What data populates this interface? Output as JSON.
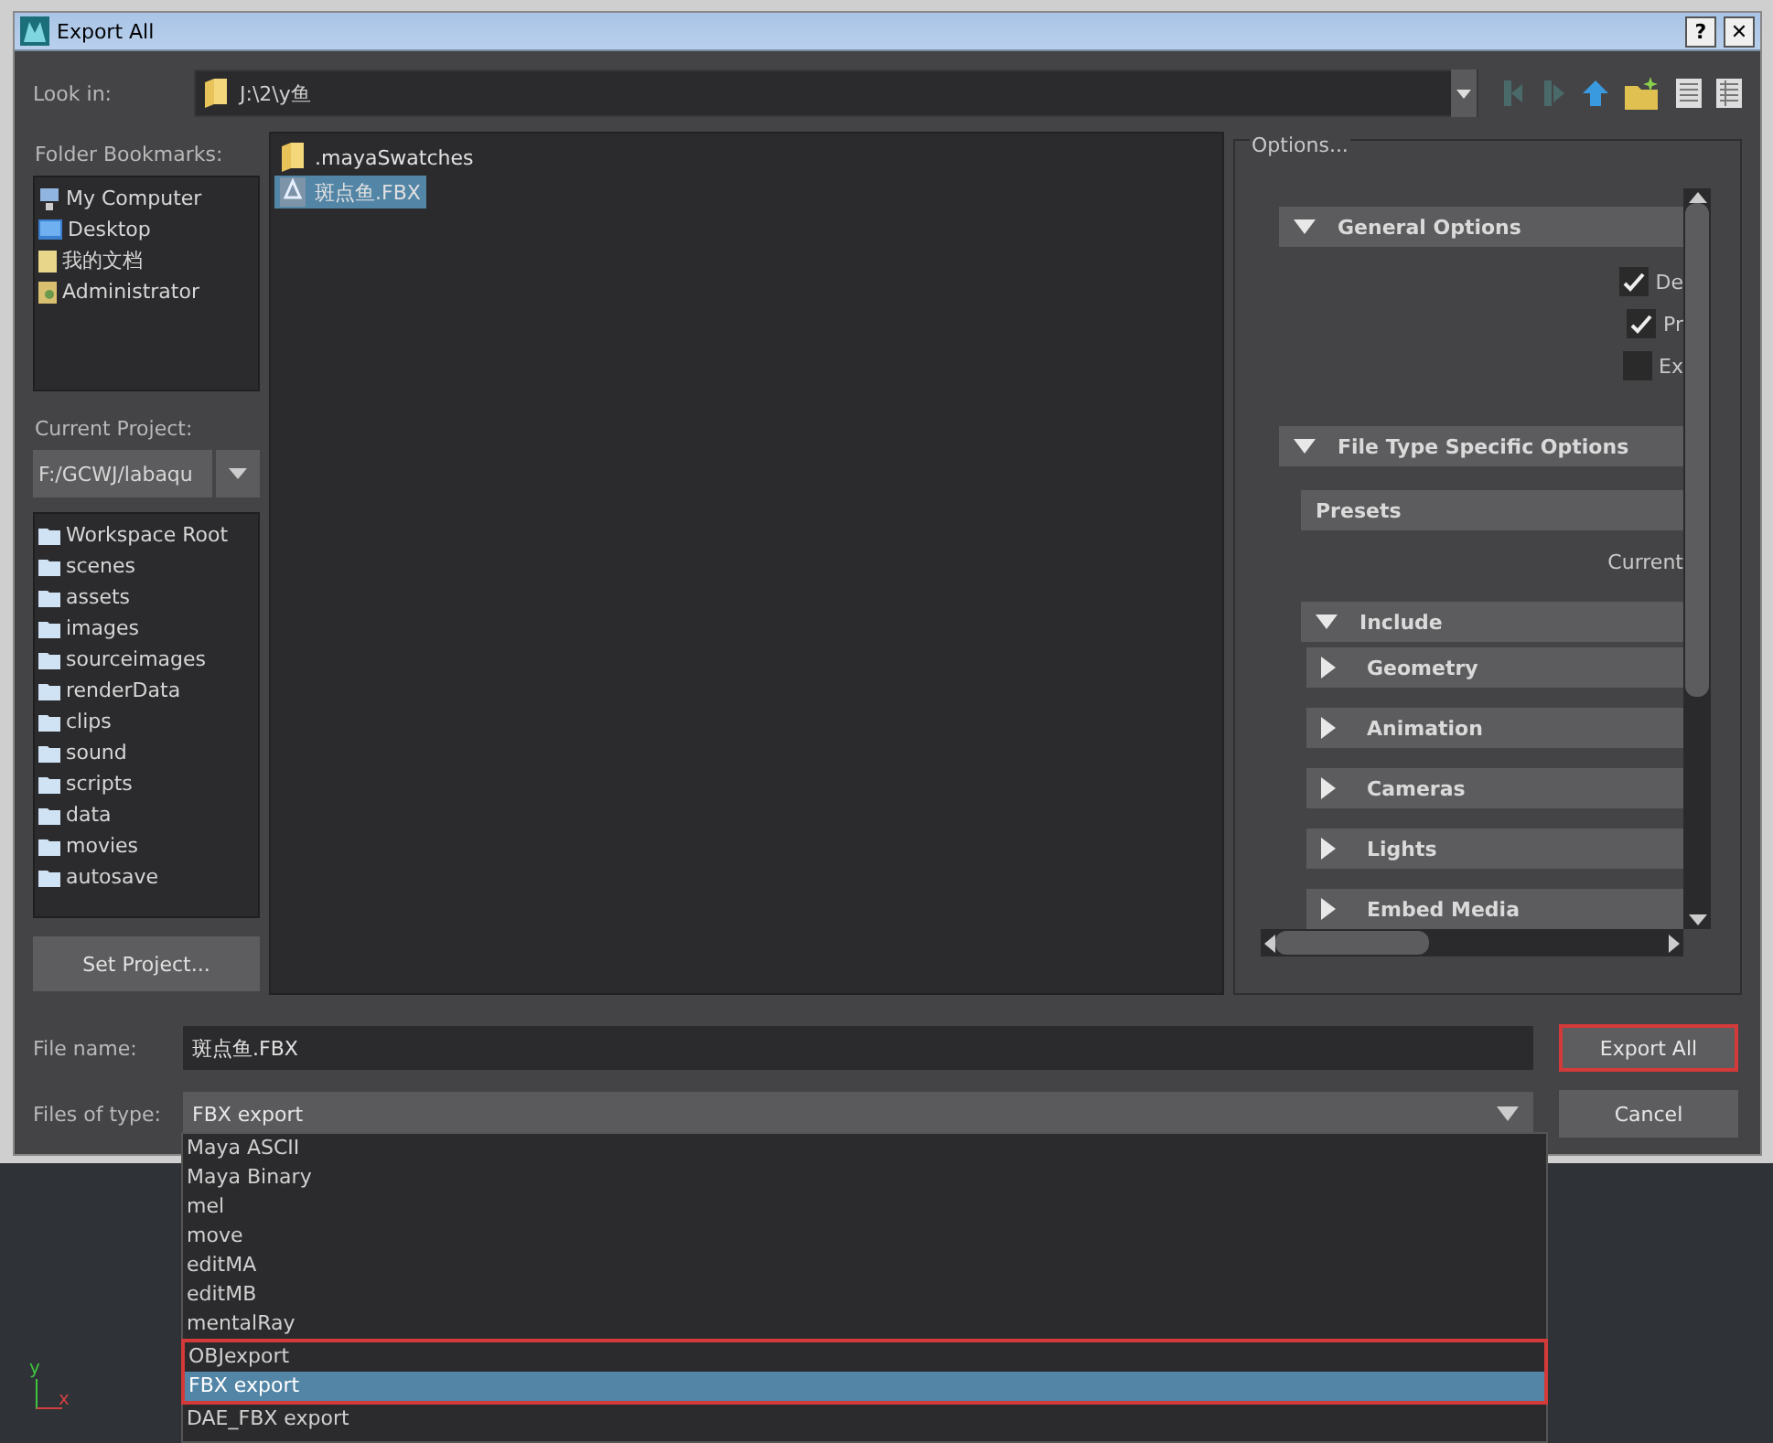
{
  "window": {
    "title": "Export All",
    "controls": [
      "?",
      "✕"
    ]
  },
  "look_in": {
    "label": "Look in:",
    "path": "J:\\2\\y鱼"
  },
  "bookmarks": {
    "label": "Folder Bookmarks:",
    "items": [
      {
        "name": "My Computer",
        "kind": "computer"
      },
      {
        "name": "Desktop",
        "kind": "desktop"
      },
      {
        "name": "我的文档",
        "kind": "documents"
      },
      {
        "name": "Administrator",
        "kind": "user"
      }
    ]
  },
  "project": {
    "label": "Current Project:",
    "value": "F:/GCWJ/labaqu",
    "folders": [
      "Workspace Root",
      "scenes",
      "assets",
      "images",
      "sourceimages",
      "renderData",
      "clips",
      "sound",
      "scripts",
      "data",
      "movies",
      "autosave"
    ],
    "button": "Set Project..."
  },
  "files": [
    {
      "name": ".mayaSwatches",
      "kind": "folder",
      "selected": false
    },
    {
      "name": "斑点鱼.FBX",
      "kind": "fbx",
      "selected": true
    }
  ],
  "options": {
    "title": "Options...",
    "general": {
      "label": "General Options",
      "expanded": true,
      "checkboxes": [
        {
          "label": "De",
          "checked": true
        },
        {
          "label": "Pr",
          "checked": true
        },
        {
          "label": "Ex",
          "checked": false
        }
      ]
    },
    "file_type": {
      "label": "File Type Specific Options",
      "expanded": true,
      "presets": {
        "label": "Presets",
        "value": "Current"
      },
      "include": {
        "label": "Include",
        "expanded": true,
        "items": [
          {
            "label": "Geometry",
            "expanded": false
          },
          {
            "label": "Animation",
            "expanded": false
          },
          {
            "label": "Cameras",
            "expanded": false
          },
          {
            "label": "Lights",
            "expanded": false
          },
          {
            "label": "Embed Media",
            "expanded": false
          }
        ]
      }
    }
  },
  "file_name": {
    "label": "File name:",
    "value": "斑点鱼.FBX"
  },
  "file_type": {
    "label": "Files of type:",
    "value": "FBX export",
    "options": [
      {
        "label": "Maya ASCII",
        "selected": false,
        "annotated": false
      },
      {
        "label": "Maya Binary",
        "selected": false,
        "annotated": false
      },
      {
        "label": "mel",
        "selected": false,
        "annotated": false
      },
      {
        "label": "move",
        "selected": false,
        "annotated": false
      },
      {
        "label": "editMA",
        "selected": false,
        "annotated": false
      },
      {
        "label": "editMB",
        "selected": false,
        "annotated": false
      },
      {
        "label": "mentalRay",
        "selected": false,
        "annotated": false
      },
      {
        "label": "OBJexport",
        "selected": false,
        "annotated": true
      },
      {
        "label": "FBX export",
        "selected": true,
        "annotated": true
      },
      {
        "label": "DAE_FBX export",
        "selected": false,
        "annotated": false
      }
    ]
  },
  "buttons": [
    {
      "label": "Export All",
      "annotated": true
    },
    {
      "label": "Cancel",
      "annotated": false
    }
  ],
  "axis": {
    "y": "y",
    "x": "x"
  }
}
